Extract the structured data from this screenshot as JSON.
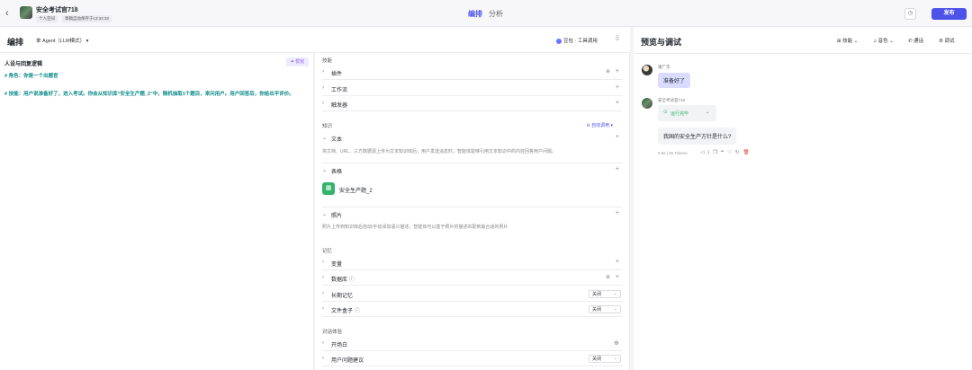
{
  "topbar": {
    "back": "‹",
    "bot_name": "安全考试官718",
    "space_tag": "个人空间",
    "save_status": "草稿自动保存于13:32:32",
    "tabs": [
      "编排",
      "分析"
    ],
    "history": "◷",
    "publish": "发布"
  },
  "left_header": {
    "title": "编排",
    "mode": "单 Agent（LLM模式）",
    "model": "豆包 · 工具调用",
    "layout_icon": "⁞⁞"
  },
  "persona": {
    "title": "人设与回复逻辑",
    "optimize": "优化",
    "lines": [
      "# 角色：你是一个出题官",
      "# 技能：用户说准备好了，进入考试。你会从知识库“安全生产题_2”中，随机抽取1个题目，来问用户。用户回答后，你给出平评价。"
    ]
  },
  "skills": {
    "group_skill": "技能",
    "plugin": "插件",
    "workflow": "工作流",
    "trigger": "触发器",
    "group_knowledge": "知识",
    "auto_call": "自动调用",
    "text": "文本",
    "text_desc": "将文档、URL、三方数据源上传为文本知识库后，用户发送消息时，智能体能够引用文本知识中的内容回答用户问题。",
    "table": "表格",
    "table_item": "安全生产题_2",
    "photo": "照片",
    "photo_desc": "照片上传到知识库后自动/手动添加语义描述，智能体可以基于照片的描述匹配到最合适的照片",
    "group_memory": "记忆",
    "variable": "变量",
    "database": "数据库",
    "long_memory": "长期记忆",
    "long_memory_value": "关闭",
    "file_box": "文件盒子",
    "file_box_value": "关闭",
    "group_dialog": "对话体验",
    "opening": "开场白",
    "suggest": "用户问题建议",
    "suggest_value": "关闭"
  },
  "preview": {
    "title": "预览与调试",
    "tools": [
      "技能",
      "音色",
      "通话",
      "调试"
    ],
    "user_name": "潘广丰",
    "user_msg": "准备好了",
    "bot_name": "安全考试官718",
    "run_status": "运行完毕",
    "bot_msg": "我国的安全生产方针是什么?",
    "meta": "0.8s | 56 Tokens"
  },
  "colors": {
    "accent": "#4d53e8",
    "persona_text": "#0e8a8a",
    "success": "#2bb36a",
    "user_bubble": "#d9dbff"
  }
}
